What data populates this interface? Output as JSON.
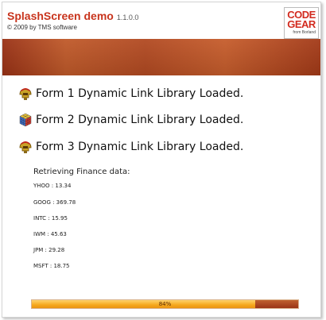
{
  "header": {
    "title": "SplashScreen demo",
    "version": "1.1.0.0",
    "copyright": "© 2009 by TMS software",
    "logo": {
      "line1": "CODE",
      "line2": "GEAR",
      "sub": "from Borland"
    }
  },
  "dll_status": [
    {
      "icon": "spartan-helmet-icon",
      "text": "Form 1 Dynamic Link Library Loaded."
    },
    {
      "icon": "rubik-cube-icon",
      "text": "Form 2 Dynamic Link Library Loaded."
    },
    {
      "icon": "spartan-helmet-icon",
      "text": "Form 3 Dynamic Link Library Loaded."
    }
  ],
  "finance": {
    "heading": "Retrieving Finance data:",
    "quotes": [
      "YHOO : 13.34",
      "GOOG : 369.78",
      "INTC : 15.95",
      "IWM : 45.63",
      "JPM : 29.28",
      "MSFT : 18.75"
    ]
  },
  "progress": {
    "value": 0.84,
    "label": "84%"
  },
  "colors": {
    "title_red": "#c8341d",
    "banner_rust": "#b24a22",
    "progress_orange": "#f5a81e"
  }
}
